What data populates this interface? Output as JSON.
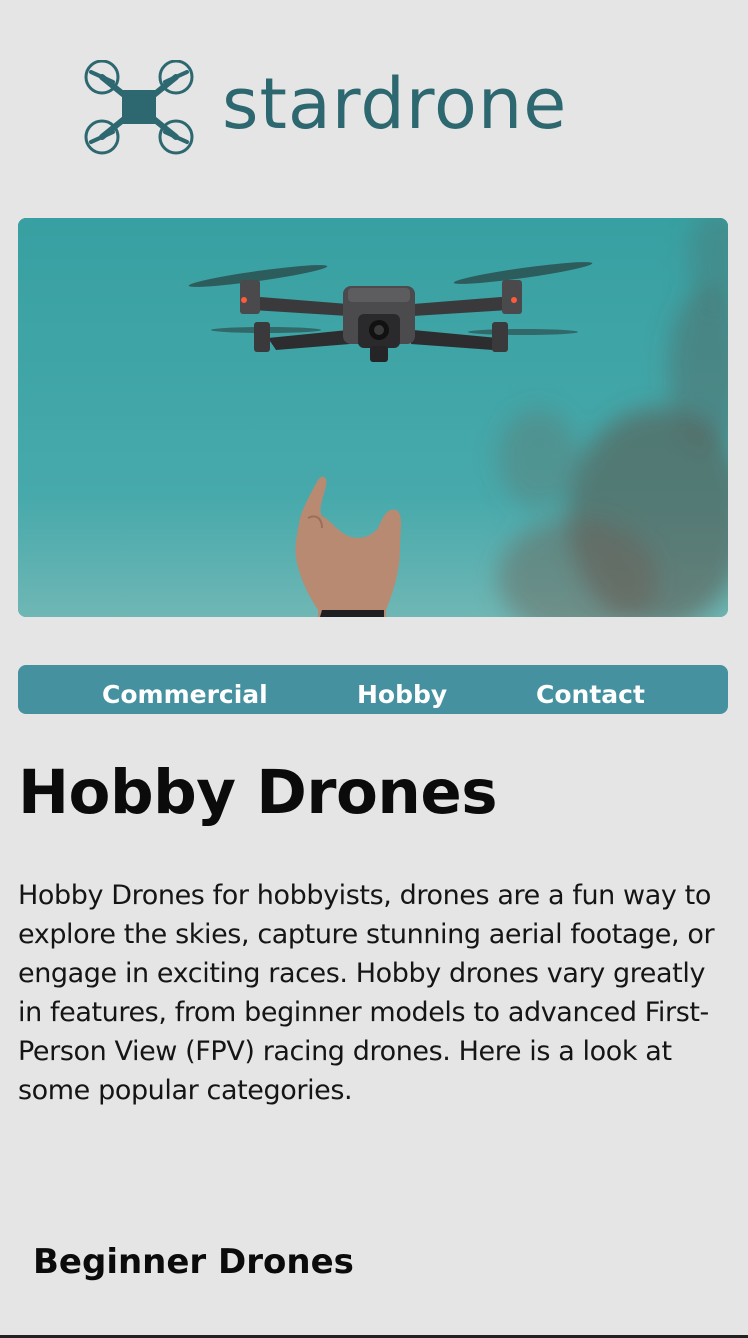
{
  "header": {
    "logo_text": "stardrone",
    "logo_icon": "quadcopter-icon",
    "brand_color": "#2d6870"
  },
  "hero": {
    "image": "drone-hovering-above-hand-photo",
    "sky_color": "#3aa3a6"
  },
  "nav": {
    "background_color": "#4591a0",
    "items": [
      {
        "label": "Commercial"
      },
      {
        "label": "Hobby"
      },
      {
        "label": "Contact"
      }
    ]
  },
  "main": {
    "title": "Hobby Drones",
    "intro": "Hobby Drones for hobbyists, drones are a fun way to explore the skies, capture stunning aerial footage, or engage in exciting races. Hobby drones vary greatly in features, from beginner models to advanced First-Person View (FPV) racing drones. Here is a look at some popular categories.",
    "section_heading": "Beginner Drones"
  }
}
